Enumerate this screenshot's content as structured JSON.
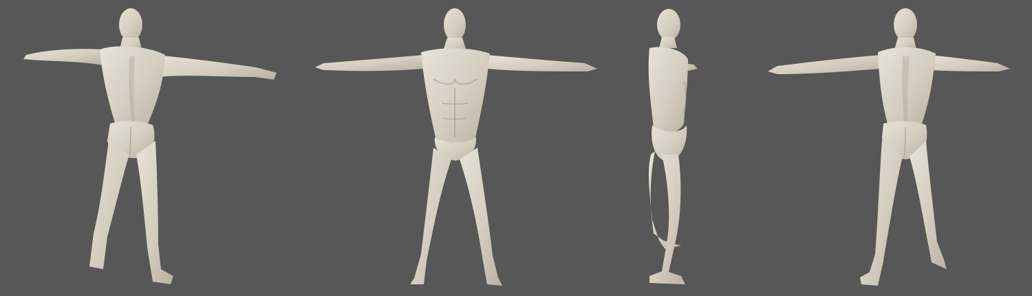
{
  "scene": {
    "background_color": "#575757",
    "skin_color": "#d6d0c4",
    "views": [
      {
        "name": "back-three-quarter"
      },
      {
        "name": "front"
      },
      {
        "name": "side"
      },
      {
        "name": "back"
      }
    ]
  }
}
